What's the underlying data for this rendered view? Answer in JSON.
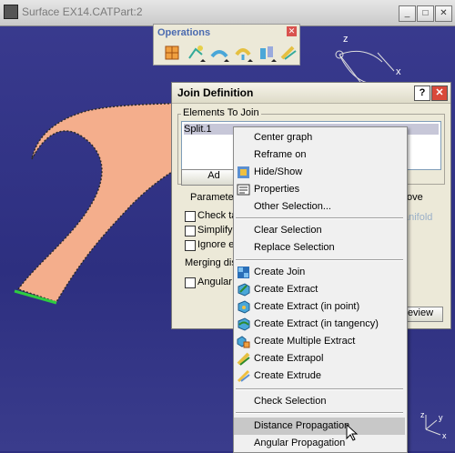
{
  "window": {
    "title": "Surface EX14.CATPart:2",
    "buttons": [
      "_",
      "□",
      "✕"
    ]
  },
  "operations": {
    "title": "Operations",
    "tools": [
      {
        "icon": "join-healing-icon"
      },
      {
        "icon": "translate-icon"
      },
      {
        "icon": "fillet-icon"
      },
      {
        "icon": "split-icon"
      },
      {
        "icon": "transformations-icon"
      },
      {
        "icon": "extrapolate-icon"
      }
    ]
  },
  "join_dialog": {
    "title": "Join Definition",
    "help": "?",
    "elements_group": "Elements To Join",
    "list_items": [
      "Split.1"
    ],
    "add_button": "Ad",
    "tab_params": "Parameter",
    "tab_remove": "ove",
    "manifold_text": "anifold",
    "check_tangency": "Check ta",
    "simplify": "Simplify",
    "ignore": "Ignore er",
    "merging": "Merging dis",
    "angular": "Angular",
    "preview_button": "eview"
  },
  "context_menu": {
    "items": [
      {
        "label": "Center graph",
        "icon": ""
      },
      {
        "label": "Reframe on",
        "icon": ""
      },
      {
        "label": "Hide/Show",
        "icon": "hide-show-icon"
      },
      {
        "label": "Properties",
        "icon": "properties-icon"
      },
      {
        "label": "Other Selection...",
        "icon": ""
      },
      {
        "label": "Clear Selection",
        "icon": ""
      },
      {
        "label": "Replace Selection",
        "icon": ""
      },
      {
        "label": "Create Join",
        "icon": "create-join-icon"
      },
      {
        "label": "Create Extract",
        "icon": "create-extract-icon"
      },
      {
        "label": "Create Extract (in point)",
        "icon": "create-extract-point-icon"
      },
      {
        "label": "Create Extract (in tangency)",
        "icon": "create-extract-tangency-icon"
      },
      {
        "label": "Create Multiple Extract",
        "icon": "create-multiple-extract-icon"
      },
      {
        "label": "Create Extrapol",
        "icon": "create-extrapol-icon"
      },
      {
        "label": "Create Extrude",
        "icon": "create-extrude-icon"
      },
      {
        "label": "Check Selection",
        "icon": ""
      },
      {
        "label": "Distance Propagation",
        "icon": ""
      },
      {
        "label": "Angular Propagation",
        "icon": ""
      }
    ],
    "highlighted": "Distance Propagation"
  },
  "axes": {
    "z": "z",
    "x": "x",
    "y": "y"
  },
  "colors": {
    "surface": "#f5b08f",
    "edge_highlight": "#2ecc40",
    "viewport_bg": "#2e2f7f"
  }
}
